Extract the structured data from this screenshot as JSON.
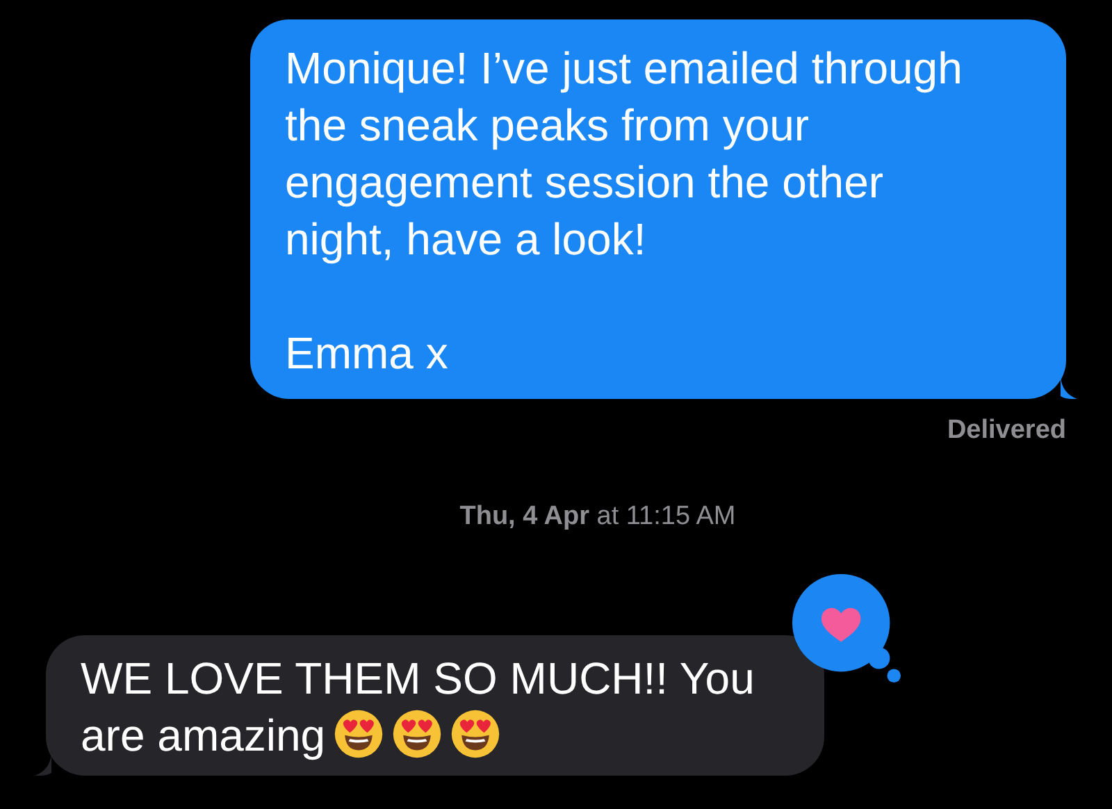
{
  "messages": [
    {
      "kind": "sent",
      "text": "Monique! I’ve just emailed through the sneak peaks from your engagement session the other night, have a look!\n\nEmma x",
      "status": "Delivered"
    },
    {
      "kind": "timestamp",
      "text": "**Thu, 4 Apr** at 11:15 AM"
    },
    {
      "kind": "received",
      "text": "WE LOVE THEM SO MUCH!! You are amazing",
      "emoji": [
        {
          "kind": "heart-eyes"
        },
        {
          "kind": "heart-eyes"
        },
        {
          "kind": "heart-eyes"
        }
      ],
      "reaction": {
        "kind": "heart"
      }
    }
  ]
}
